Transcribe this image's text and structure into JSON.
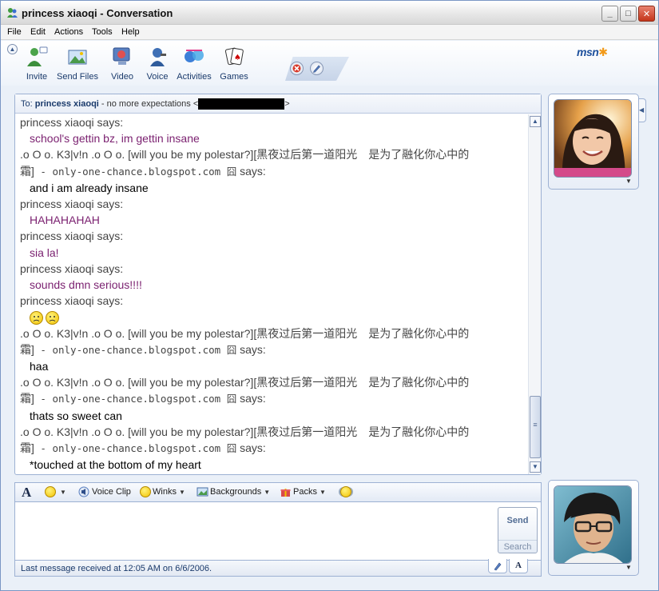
{
  "window": {
    "title": "princess xiaoqi - Conversation",
    "minimize_glyph": "_",
    "maximize_glyph": "□",
    "close_glyph": "✕"
  },
  "menu": [
    "File",
    "Edit",
    "Actions",
    "Tools",
    "Help"
  ],
  "toolbar": {
    "collapse_glyph": "▲",
    "tools": [
      {
        "label": "Invite",
        "icon": "invite-icon"
      },
      {
        "label": "Send Files",
        "icon": "send-files-icon"
      },
      {
        "label": "Video",
        "icon": "video-icon"
      },
      {
        "label": "Voice",
        "icon": "voice-icon"
      },
      {
        "label": "Activities",
        "icon": "activities-icon"
      },
      {
        "label": "Games",
        "icon": "games-icon"
      }
    ],
    "block_icon": "block-icon",
    "edit_icon": "pencil-icon",
    "logo": "msn"
  },
  "to_bar": {
    "label": "To:",
    "name": "princess xiaoqi",
    "personal_message": " - no more expectations <",
    "close_bracket": ">"
  },
  "colors": {
    "her_text": "#7a1f6f",
    "my_text": "#000000",
    "name_text": "#444444",
    "accent": "#1a3a6b"
  },
  "conversation": [
    {
      "type": "says",
      "sender": "princess xiaoqi",
      "suffix": " says:"
    },
    {
      "type": "msg",
      "who": "her",
      "text": "school's gettin bz, im gettin insane"
    },
    {
      "type": "says",
      "sender": ".o O o. K3|v!n .o O o. [will you be my polestar?][黑夜过后第一道阳光　是为了融化你心中的",
      "sender2": "霜]",
      "mono": " - only-one-chance.blogspot.com 囧",
      "suffix": " says:"
    },
    {
      "type": "msg",
      "who": "me",
      "text": "and i am already insane"
    },
    {
      "type": "says",
      "sender": "princess xiaoqi",
      "suffix": " says:"
    },
    {
      "type": "msg",
      "who": "her",
      "text": "HAHAHAHAH"
    },
    {
      "type": "says",
      "sender": "princess xiaoqi",
      "suffix": " says:"
    },
    {
      "type": "msg",
      "who": "her",
      "text": "sia la!"
    },
    {
      "type": "says",
      "sender": "princess xiaoqi",
      "suffix": " says:"
    },
    {
      "type": "msg",
      "who": "her",
      "text": "sounds dmn serious!!!!"
    },
    {
      "type": "says",
      "sender": "princess xiaoqi",
      "suffix": " says:"
    },
    {
      "type": "emoticons",
      "icons": [
        "sad-emoticon-icon",
        "sad-emoticon-icon"
      ]
    },
    {
      "type": "says",
      "sender": ".o O o. K3|v!n .o O o. [will you be my polestar?][黑夜过后第一道阳光　是为了融化你心中的",
      "sender2": "霜]",
      "mono": " - only-one-chance.blogspot.com 囧",
      "suffix": " says:"
    },
    {
      "type": "msg",
      "who": "me",
      "text": "haa"
    },
    {
      "type": "says",
      "sender": ".o O o. K3|v!n .o O o. [will you be my polestar?][黑夜过后第一道阳光　是为了融化你心中的",
      "sender2": "霜]",
      "mono": " - only-one-chance.blogspot.com 囧",
      "suffix": " says:"
    },
    {
      "type": "msg",
      "who": "me",
      "text": "thats so sweet can"
    },
    {
      "type": "says",
      "sender": ".o O o. K3|v!n .o O o. [will you be my polestar?][黑夜过后第一道阳光　是为了融化你心中的",
      "sender2": "霜]",
      "mono": " - only-one-chance.blogspot.com 囧",
      "suffix": " says:"
    },
    {
      "type": "msg",
      "who": "me",
      "text": "*touched at the bottom of my heart"
    }
  ],
  "scrollbar": {
    "up_glyph": "▲",
    "down_glyph": "▼",
    "grip_glyph": "≡"
  },
  "format_bar": {
    "font_glyph": "A",
    "emoticon_icon": "smiley-icon",
    "voice_clip": "Voice Clip",
    "winks": "Winks",
    "backgrounds": "Backgrounds",
    "packs": "Packs",
    "nudge_icon": "nudge-icon",
    "caret": "▼"
  },
  "compose": {
    "value": "",
    "placeholder": ""
  },
  "buttons": {
    "send": "Send",
    "search": "Search"
  },
  "status": {
    "text": "Last message received at 12:05 AM on 6/6/2006.",
    "tab_handwriting_icon": "pen-icon",
    "tab_type_glyph": "A"
  },
  "display_pictures": {
    "contact_alt": "contact display picture",
    "me_alt": "my display picture",
    "caret": "▼",
    "side_tab_glyph": "◀"
  }
}
